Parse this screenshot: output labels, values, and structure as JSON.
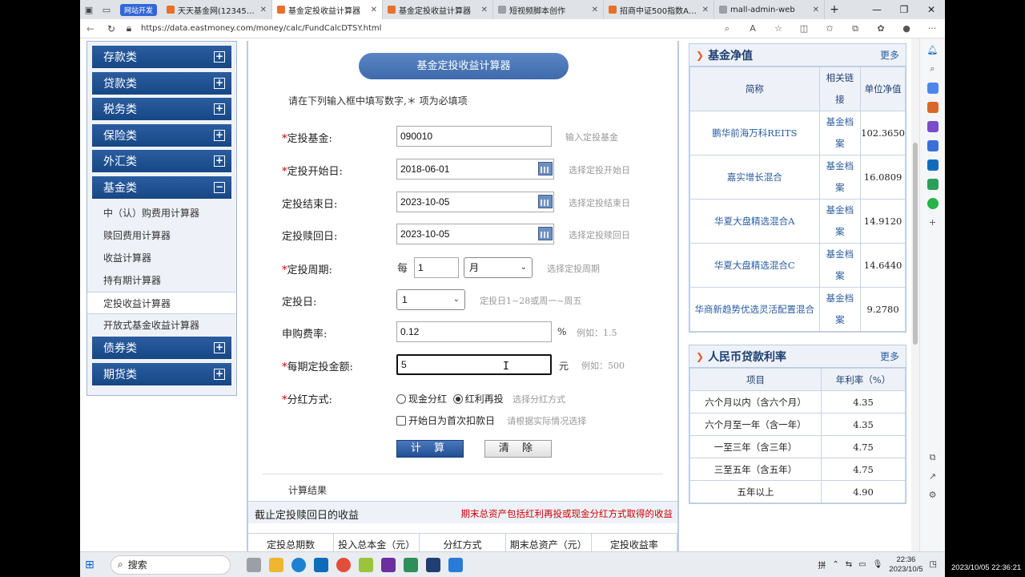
{
  "browser": {
    "tab_group": "网站开发",
    "tabs": [
      {
        "title": "天天基金网(1234567.c",
        "active": false
      },
      {
        "title": "基金定投收益计算器",
        "active": true
      },
      {
        "title": "基金定投收益计算器",
        "active": false
      },
      {
        "title": "短视频脚本创作",
        "active": false
      },
      {
        "title": "招商中证500指数A(00",
        "active": false
      },
      {
        "title": "mall-admin-web",
        "active": false
      }
    ],
    "url": "https://data.eastmoney.com/money/calc/FundCalcDTSY.html"
  },
  "left_menu": {
    "categories_top": [
      "存款类",
      "贷款类",
      "税务类",
      "保险类",
      "外汇类",
      "基金类"
    ],
    "fund_items": [
      "中（认）购费用计算器",
      "赎回费用计算器",
      "收益计算器",
      "持有期计算器",
      "定投收益计算器",
      "开放式基金收益计算器"
    ],
    "active_item": "定投收益计算器",
    "categories_bottom": [
      "债券类",
      "期货类"
    ]
  },
  "form": {
    "title": "基金定投收益计算器",
    "intro": "请在下列输入框中填写数字,＊ 项为必填项",
    "fund": {
      "label": "定投基金:",
      "value": "090010",
      "hint": "输入定投基金"
    },
    "start_date": {
      "label": "定投开始日:",
      "value": "2018-06-01",
      "hint": "选择定投开始日"
    },
    "end_date": {
      "label": "定投结束日:",
      "value": "2023-10-05",
      "hint": "选择定投结束日"
    },
    "redeem_date": {
      "label": "定投赎回日:",
      "value": "2023-10-05",
      "hint": "选择定投赎回日"
    },
    "period": {
      "label": "定投周期:",
      "prefix": "每",
      "value": "1",
      "unit": "月",
      "hint": "选择定投周期"
    },
    "day": {
      "label": "定投日:",
      "value": "1",
      "hint": "定投日1~28或周一~周五"
    },
    "fee": {
      "label": "申购费率:",
      "value": "0.12",
      "unit": "%",
      "hint": "例如：1.5"
    },
    "amount": {
      "label": "每期定投金额:",
      "value": "5",
      "unit": "元",
      "hint": "例如：500"
    },
    "dividend": {
      "label": "分红方式:",
      "opt_cash": "现金分红",
      "opt_reinvest": "红利再投",
      "hint": "选择分红方式"
    },
    "first_deduct": {
      "label": "开始日为首次扣款日",
      "hint": "请根据实际情况选择"
    },
    "calc_button": "计 算",
    "clear_button": "清 除",
    "result_title": "计算结果",
    "result_bar_left": "截止定投赎回日的收益",
    "result_bar_right": "期末总资产包括红利再投或现金分红方式取得的收益",
    "result_columns": [
      "定投总期数",
      "投入总本金（元）",
      "分红方式",
      "期末总资产（元）",
      "定投收益率"
    ]
  },
  "nav_panel": {
    "title": "基金净值",
    "more": "更多",
    "headers": [
      "简称",
      "相关链接",
      "单位净值"
    ],
    "link_text": "基金档案",
    "rows": [
      {
        "name": "鹏华前海万科REITS",
        "nav": "102.3650"
      },
      {
        "name": "嘉实增长混合",
        "nav": "16.0809"
      },
      {
        "name": "华夏大盘精选混合A",
        "nav": "14.9120"
      },
      {
        "name": "华夏大盘精选混合C",
        "nav": "14.6440"
      },
      {
        "name": "华商新趋势优选灵活配置混合",
        "nav": "9.2780"
      }
    ]
  },
  "rate_panel": {
    "title": "人民币贷款利率",
    "more": "更多",
    "headers": [
      "项目",
      "年利率（%）"
    ],
    "rows": [
      {
        "item": "六个月以内（含六个月）",
        "rate": "4.35"
      },
      {
        "item": "六个月至一年（含一年）",
        "rate": "4.35"
      },
      {
        "item": "一至三年（含三年）",
        "rate": "4.75"
      },
      {
        "item": "三至五年（含五年）",
        "rate": "4.75"
      },
      {
        "item": "五年以上",
        "rate": "4.90"
      }
    ]
  },
  "taskbar": {
    "search_label": "搜索",
    "time": "22:36",
    "date": "2023/10/5"
  },
  "overlay_timestamp": "2023/10/05 22:36:21",
  "colors": {
    "menu_blue": "#1f5195",
    "accent_red": "#cc0000",
    "link_blue": "#2a5da0"
  }
}
